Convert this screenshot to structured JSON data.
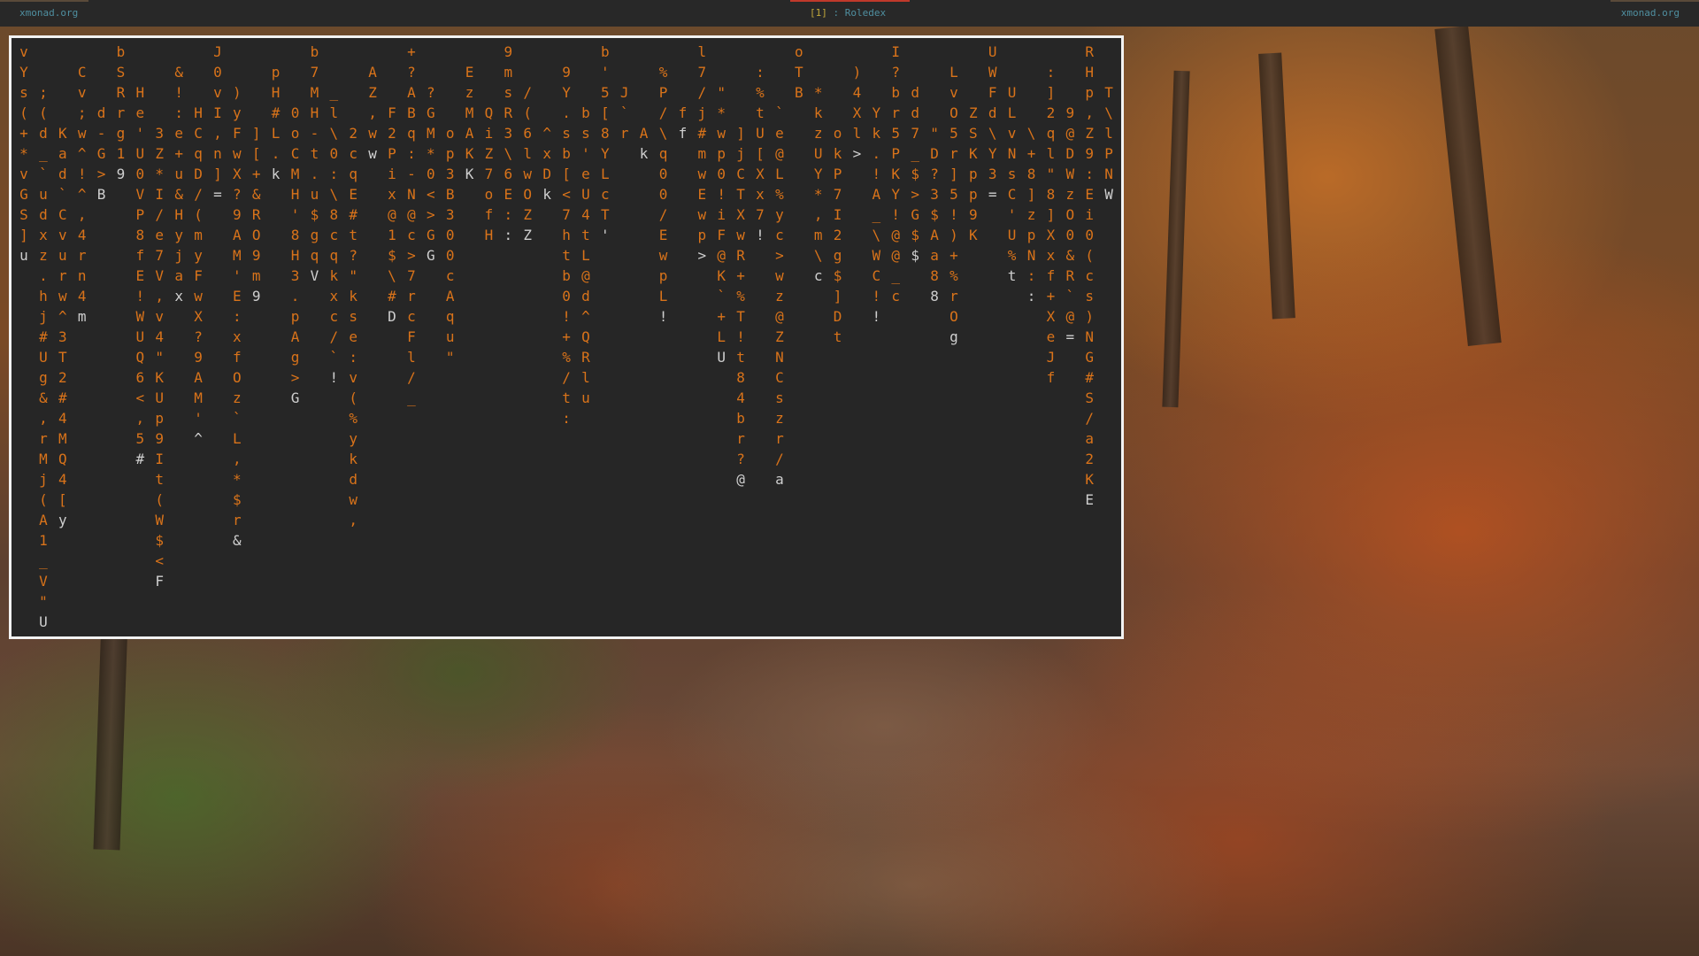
{
  "topbar": {
    "left_label": "xmonad.org",
    "workspace": "[1]",
    "separator": " : ",
    "window_title": "Roledex",
    "right_label": "xmonad.org"
  },
  "colors": {
    "bar_bg": "#282828",
    "bar_text": "#4f8fa0",
    "workspace_text": "#c2a83b",
    "active_marker": "#c0392b",
    "terminal_bg": "#262626",
    "terminal_border": "#f2f2f2",
    "rain_fg": "#d9731a",
    "rain_head": "#cfcfcf"
  },
  "terminal": {
    "program": "cmatrix-style character rain",
    "columns": [
      {
        "c": "vYs(+*vGS]",
        "h": "u"
      },
      {
        "c": ";(d_`udxz.hj#Ug&,rMj(A1_V\"",
        "h": "U"
      },
      {
        "c": "Kad`Cvurw^3T2#4MQ4[",
        "h": "y"
      },
      {
        "c": "Cv;w^!^,4rn4",
        "h": "m"
      },
      {
        "c": "d-G>",
        "h": "B"
      },
      {
        "c": "bSRrg1",
        "h": "9"
      },
      {
        "c": "He'U0VP8fE!WUQ6<,5",
        "h": "#"
      },
      {
        "c": "3Z*I/e7V,v4\"KUp9It(W$<",
        "h": "F"
      },
      {
        "c": "&!:e+u&Hyja",
        "h": "x"
      },
      {
        "c": "HCqD/(myFwX?9AM'",
        "h": "^"
      },
      {
        "c": "J0vI,n]",
        "h": "="
      },
      {
        "c": ")yFwX?9AM'E:xfOz`L,*$r",
        "h": "&"
      },
      {
        "c": "][+&RO9m",
        "h": "9"
      },
      {
        "c": "pH#L.",
        "h": "k"
      },
      {
        "c": "0oCMH'8H3.pAg>",
        "h": "G"
      },
      {
        "c": "b7MH-t.u$gq",
        "h": "V"
      },
      {
        "c": "_l\\0:\\8cqkxc/`",
        "h": "!"
      },
      {
        "c": "2cqE#t?\"kse:v(%ykdw,",
        "h": ""
      },
      {
        "c": "AZ,w",
        "h": "w"
      },
      {
        "c": "F2Pix@1$\\#",
        "h": "D"
      },
      {
        "c": "+?ABq:-N@c>7rcFl/_",
        "h": ""
      },
      {
        "c": "?GM*0<>G",
        "h": "G"
      },
      {
        "c": "op3B300cAqu\"",
        "h": ""
      },
      {
        "c": "EzMAK",
        "h": "K"
      },
      {
        "c": "QiZ7ofH",
        "h": ""
      },
      {
        "c": "9msR3\\6E:",
        "h": ":"
      },
      {
        "c": "/(6lwOZ",
        "h": "Z"
      },
      {
        "c": "^xD",
        "h": "k"
      },
      {
        "c": "9Y.sb[<7htb0!+%/t:",
        "h": ""
      },
      {
        "c": "bs'eU4tL@d^QRlu",
        "h": ""
      },
      {
        "c": "b'5[8YLcT",
        "h": "'"
      },
      {
        "c": "J`r",
        "h": ""
      },
      {
        "c": "A",
        "h": "k"
      },
      {
        "c": "%P/\\q00/EwpL",
        "h": "!"
      },
      {
        "c": "f",
        "h": "f"
      },
      {
        "c": "l7/j#mwEwp",
        "h": ">"
      },
      {
        "c": "\"*wp0!iF@K`+L",
        "h": "U"
      },
      {
        "c": "]jCTXwR+%T!t84br?",
        "h": "@"
      },
      {
        "c": ":%tU[Xx7",
        "h": "!"
      },
      {
        "c": "`e@L%yc>wz@ZNCszr/",
        "h": "a"
      },
      {
        "c": "oTB",
        "h": ""
      },
      {
        "c": "*kzUY*,m\\",
        "h": "c"
      },
      {
        "c": "okP7I2g$]Dt",
        "h": ""
      },
      {
        "c": ")4Xl",
        "h": ">"
      },
      {
        "c": "Yk.!A_\\WC!",
        "h": "!"
      },
      {
        "c": "I?br5PKY!@@_c",
        "h": ""
      },
      {
        "c": "dd7_$>G$",
        "h": "$"
      },
      {
        "c": "\"D?3$Aa8",
        "h": "8"
      },
      {
        "c": "LvO5r]5!)+%rO",
        "h": "g"
      },
      {
        "c": "ZSKpp9K",
        "h": ""
      },
      {
        "c": "UWFd\\Y3",
        "h": "="
      },
      {
        "c": "ULvNsC'U%",
        "h": "t"
      },
      {
        "c": "\\+8]zpN:",
        "h": ":"
      },
      {
        "c": ":]2ql\"8]Xxf+XeJf",
        "h": ""
      },
      {
        "c": "9@DWzO0&R`@",
        "h": "="
      },
      {
        "c": "RHp,Z9:Ei0(cs)NG#S/a2K",
        "h": "E"
      },
      {
        "c": "T\\lPN",
        "h": "W"
      }
    ]
  }
}
